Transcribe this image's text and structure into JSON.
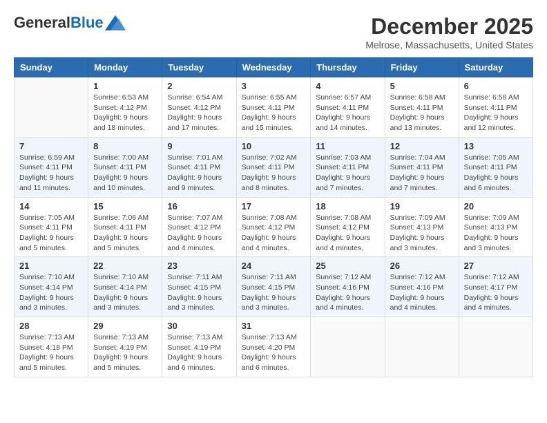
{
  "header": {
    "logo_general": "General",
    "logo_blue": "Blue",
    "month_title": "December 2025",
    "location": "Melrose, Massachusetts, United States"
  },
  "weekdays": [
    "Sunday",
    "Monday",
    "Tuesday",
    "Wednesday",
    "Thursday",
    "Friday",
    "Saturday"
  ],
  "weeks": [
    [
      {
        "day": "",
        "sunrise": "",
        "sunset": "",
        "daylight": "",
        "empty": true
      },
      {
        "day": "1",
        "sunrise": "Sunrise: 6:53 AM",
        "sunset": "Sunset: 4:12 PM",
        "daylight": "Daylight: 9 hours and 18 minutes."
      },
      {
        "day": "2",
        "sunrise": "Sunrise: 6:54 AM",
        "sunset": "Sunset: 4:12 PM",
        "daylight": "Daylight: 9 hours and 17 minutes."
      },
      {
        "day": "3",
        "sunrise": "Sunrise: 6:55 AM",
        "sunset": "Sunset: 4:11 PM",
        "daylight": "Daylight: 9 hours and 15 minutes."
      },
      {
        "day": "4",
        "sunrise": "Sunrise: 6:57 AM",
        "sunset": "Sunset: 4:11 PM",
        "daylight": "Daylight: 9 hours and 14 minutes."
      },
      {
        "day": "5",
        "sunrise": "Sunrise: 6:58 AM",
        "sunset": "Sunset: 4:11 PM",
        "daylight": "Daylight: 9 hours and 13 minutes."
      },
      {
        "day": "6",
        "sunrise": "Sunrise: 6:58 AM",
        "sunset": "Sunset: 4:11 PM",
        "daylight": "Daylight: 9 hours and 12 minutes."
      }
    ],
    [
      {
        "day": "7",
        "sunrise": "Sunrise: 6:59 AM",
        "sunset": "Sunset: 4:11 PM",
        "daylight": "Daylight: 9 hours and 11 minutes."
      },
      {
        "day": "8",
        "sunrise": "Sunrise: 7:00 AM",
        "sunset": "Sunset: 4:11 PM",
        "daylight": "Daylight: 9 hours and 10 minutes."
      },
      {
        "day": "9",
        "sunrise": "Sunrise: 7:01 AM",
        "sunset": "Sunset: 4:11 PM",
        "daylight": "Daylight: 9 hours and 9 minutes."
      },
      {
        "day": "10",
        "sunrise": "Sunrise: 7:02 AM",
        "sunset": "Sunset: 4:11 PM",
        "daylight": "Daylight: 9 hours and 8 minutes."
      },
      {
        "day": "11",
        "sunrise": "Sunrise: 7:03 AM",
        "sunset": "Sunset: 4:11 PM",
        "daylight": "Daylight: 9 hours and 7 minutes."
      },
      {
        "day": "12",
        "sunrise": "Sunrise: 7:04 AM",
        "sunset": "Sunset: 4:11 PM",
        "daylight": "Daylight: 9 hours and 7 minutes."
      },
      {
        "day": "13",
        "sunrise": "Sunrise: 7:05 AM",
        "sunset": "Sunset: 4:11 PM",
        "daylight": "Daylight: 9 hours and 6 minutes."
      }
    ],
    [
      {
        "day": "14",
        "sunrise": "Sunrise: 7:05 AM",
        "sunset": "Sunset: 4:11 PM",
        "daylight": "Daylight: 9 hours and 5 minutes."
      },
      {
        "day": "15",
        "sunrise": "Sunrise: 7:06 AM",
        "sunset": "Sunset: 4:11 PM",
        "daylight": "Daylight: 9 hours and 5 minutes."
      },
      {
        "day": "16",
        "sunrise": "Sunrise: 7:07 AM",
        "sunset": "Sunset: 4:12 PM",
        "daylight": "Daylight: 9 hours and 4 minutes."
      },
      {
        "day": "17",
        "sunrise": "Sunrise: 7:08 AM",
        "sunset": "Sunset: 4:12 PM",
        "daylight": "Daylight: 9 hours and 4 minutes."
      },
      {
        "day": "18",
        "sunrise": "Sunrise: 7:08 AM",
        "sunset": "Sunset: 4:12 PM",
        "daylight": "Daylight: 9 hours and 4 minutes."
      },
      {
        "day": "19",
        "sunrise": "Sunrise: 7:09 AM",
        "sunset": "Sunset: 4:13 PM",
        "daylight": "Daylight: 9 hours and 3 minutes."
      },
      {
        "day": "20",
        "sunrise": "Sunrise: 7:09 AM",
        "sunset": "Sunset: 4:13 PM",
        "daylight": "Daylight: 9 hours and 3 minutes."
      }
    ],
    [
      {
        "day": "21",
        "sunrise": "Sunrise: 7:10 AM",
        "sunset": "Sunset: 4:14 PM",
        "daylight": "Daylight: 9 hours and 3 minutes."
      },
      {
        "day": "22",
        "sunrise": "Sunrise: 7:10 AM",
        "sunset": "Sunset: 4:14 PM",
        "daylight": "Daylight: 9 hours and 3 minutes."
      },
      {
        "day": "23",
        "sunrise": "Sunrise: 7:11 AM",
        "sunset": "Sunset: 4:15 PM",
        "daylight": "Daylight: 9 hours and 3 minutes."
      },
      {
        "day": "24",
        "sunrise": "Sunrise: 7:11 AM",
        "sunset": "Sunset: 4:15 PM",
        "daylight": "Daylight: 9 hours and 3 minutes."
      },
      {
        "day": "25",
        "sunrise": "Sunrise: 7:12 AM",
        "sunset": "Sunset: 4:16 PM",
        "daylight": "Daylight: 9 hours and 4 minutes."
      },
      {
        "day": "26",
        "sunrise": "Sunrise: 7:12 AM",
        "sunset": "Sunset: 4:16 PM",
        "daylight": "Daylight: 9 hours and 4 minutes."
      },
      {
        "day": "27",
        "sunrise": "Sunrise: 7:12 AM",
        "sunset": "Sunset: 4:17 PM",
        "daylight": "Daylight: 9 hours and 4 minutes."
      }
    ],
    [
      {
        "day": "28",
        "sunrise": "Sunrise: 7:13 AM",
        "sunset": "Sunset: 4:18 PM",
        "daylight": "Daylight: 9 hours and 5 minutes."
      },
      {
        "day": "29",
        "sunrise": "Sunrise: 7:13 AM",
        "sunset": "Sunset: 4:19 PM",
        "daylight": "Daylight: 9 hours and 5 minutes."
      },
      {
        "day": "30",
        "sunrise": "Sunrise: 7:13 AM",
        "sunset": "Sunset: 4:19 PM",
        "daylight": "Daylight: 9 hours and 6 minutes."
      },
      {
        "day": "31",
        "sunrise": "Sunrise: 7:13 AM",
        "sunset": "Sunset: 4:20 PM",
        "daylight": "Daylight: 9 hours and 6 minutes."
      },
      {
        "day": "",
        "sunrise": "",
        "sunset": "",
        "daylight": "",
        "empty": true
      },
      {
        "day": "",
        "sunrise": "",
        "sunset": "",
        "daylight": "",
        "empty": true
      },
      {
        "day": "",
        "sunrise": "",
        "sunset": "",
        "daylight": "",
        "empty": true
      }
    ]
  ]
}
